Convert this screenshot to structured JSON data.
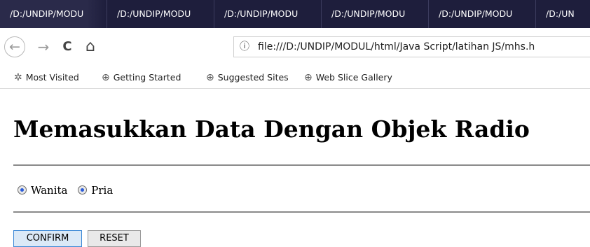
{
  "tabs": [
    "/D:/UNDIP/MODU",
    "/D:/UNDIP/MODU",
    "/D:/UNDIP/MODU",
    "/D:/UNDIP/MODU",
    "/D:/UNDIP/MODU",
    "/D:/UN"
  ],
  "navbar": {
    "back_icon": "←",
    "forward_icon": "→",
    "reload_icon": "C",
    "home_icon": "⌂",
    "info_icon": "ⓘ",
    "url": "file:///D:/UNDIP/MODUL/html/Java Script/latihan JS/mhs.h"
  },
  "bookmarks": [
    {
      "icon": "gear-icon",
      "glyph": "✲",
      "label": "Most Visited"
    },
    {
      "icon": "globe-icon",
      "glyph": "⊕",
      "label": "Getting Started"
    },
    {
      "icon": "globe-icon",
      "glyph": "⊕",
      "label": "Suggested Sites"
    },
    {
      "icon": "globe-icon",
      "glyph": "⊕",
      "label": "Web Slice Gallery"
    }
  ],
  "page": {
    "heading": "Memasukkan Data Dengan Objek Radio",
    "radio_options": [
      "Wanita",
      "Pria"
    ],
    "confirm_label": "CONFIRM",
    "reset_label": "RESET"
  },
  "colors": {
    "tabstrip": "#1e1e3c",
    "radio_selected": "#2a5bd8",
    "confirm_border": "#3a87d6"
  }
}
